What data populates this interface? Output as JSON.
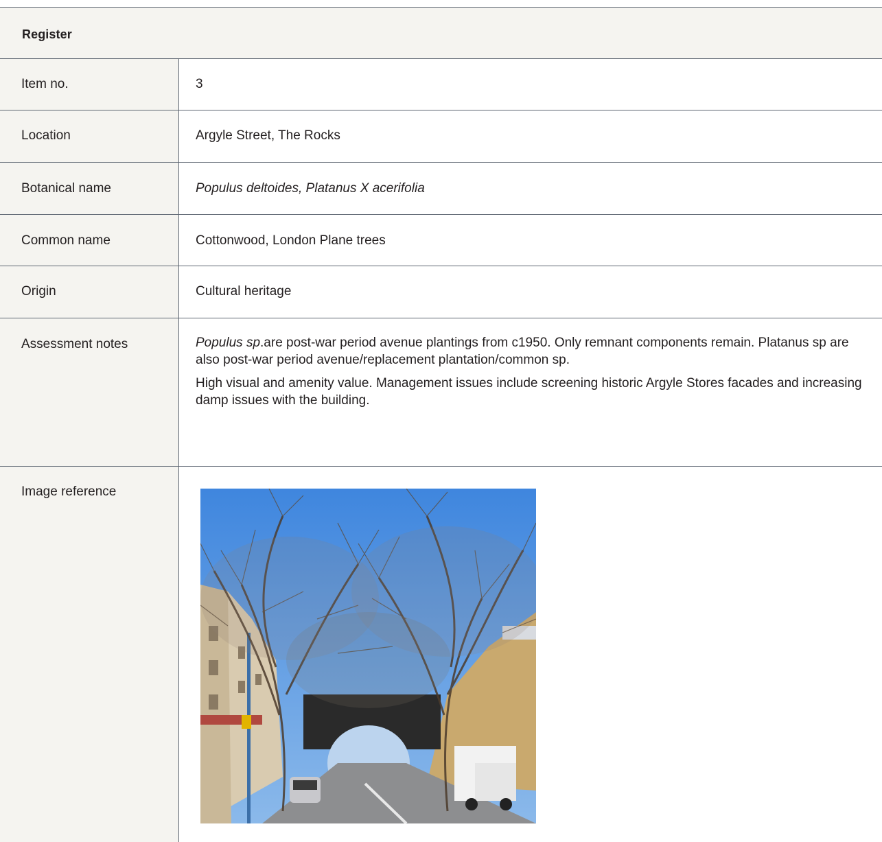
{
  "header": {
    "title": "Register"
  },
  "rows": [
    {
      "label": "Item no.",
      "value": "3"
    },
    {
      "label": "Location",
      "value": "Argyle Street, The Rocks"
    },
    {
      "label": "Botanical name",
      "value": "Populus deltoides, Platanus X acerifolia"
    },
    {
      "label": "Common name",
      "value": "Cottonwood, London Plane trees"
    },
    {
      "label": "Origin",
      "value": "Cultural heritage"
    }
  ],
  "assessment": {
    "label": "Assessment notes",
    "para1_italic": "Populus sp",
    "para1_rest": ".are post-war period avenue plantings from c1950. Only remnant components remain. Platanus sp are also post-war period avenue/replacement plantation/common sp.",
    "para2": "High visual and amenity value. Management issues include screening historic Argyle Stores facades and increasing damp issues with the building."
  },
  "image_reference": {
    "label": "Image reference",
    "photo": "street-trees-photo"
  }
}
